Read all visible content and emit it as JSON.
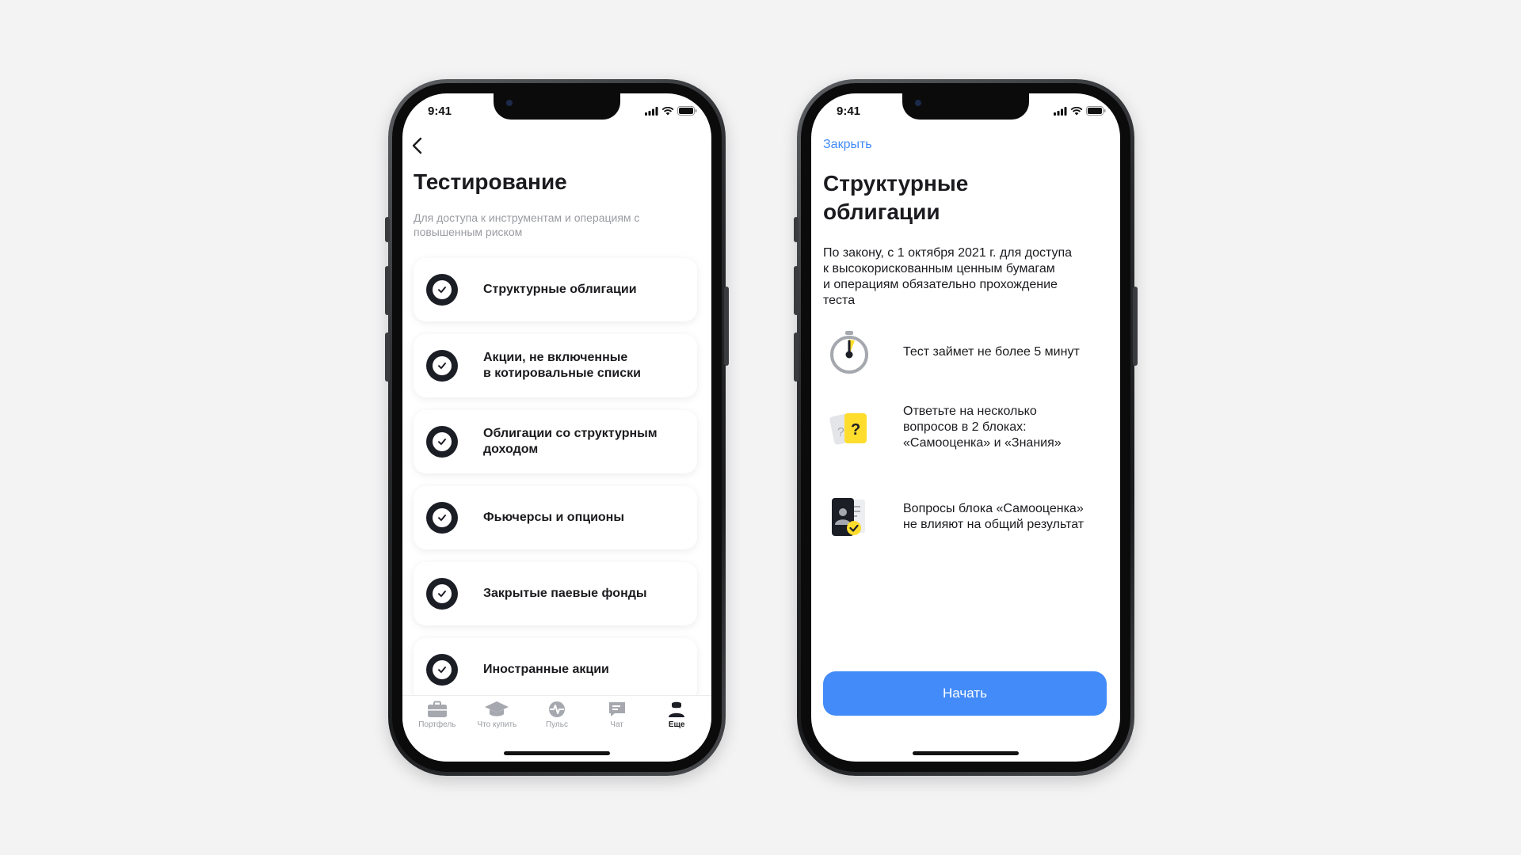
{
  "status_bar": {
    "time": "9:41"
  },
  "left_screen": {
    "title": "Тестирование",
    "subtitle": "Для доступа к инструментам и операциям с повышенным риском",
    "tests": [
      {
        "label": "Структурные облигации",
        "icon": "check-icon"
      },
      {
        "label": "Акции, не включенные\nв котировальные списки",
        "icon": "check-icon"
      },
      {
        "label": "Облигации со структурным\nдоходом",
        "icon": "check-icon"
      },
      {
        "label": "Фьючерсы и опционы",
        "icon": "check-icon"
      },
      {
        "label": "Закрытые паевые фонды",
        "icon": "check-icon"
      },
      {
        "label": "Иностранные акции",
        "icon": "check-icon"
      }
    ],
    "tabbar": [
      {
        "label": "Портфель",
        "icon": "briefcase-icon",
        "active": false
      },
      {
        "label": "Что купить",
        "icon": "graduation-cap-icon",
        "active": false
      },
      {
        "label": "Пульс",
        "icon": "pulse-icon",
        "active": false
      },
      {
        "label": "Чат",
        "icon": "chat-icon",
        "active": false
      },
      {
        "label": "Еще",
        "icon": "profile-icon",
        "active": true
      }
    ]
  },
  "right_screen": {
    "close_label": "Закрыть",
    "title": "Структурные\nоблигации",
    "intro": "По закону, с 1 октября 2021 г. для доступа\nк высокорискованным ценным бумагам\nи операциям обязательно прохождение\nтеста",
    "info": [
      {
        "text": "Тест займет не более 5 минут",
        "icon": "stopwatch-icon"
      },
      {
        "text": "Ответьте на несколько\nвопросов в 2 блоках:\n«Самооценка» и «Знания»",
        "icon": "question-cards-icon"
      },
      {
        "text": "Вопросы блока «Самооценка»\nне влияют на общий результат",
        "icon": "id-card-check-icon"
      }
    ],
    "start_label": "Начать"
  },
  "colors": {
    "accent_blue": "#428bf9",
    "dark": "#1c1e26",
    "yellow": "#ffdd2d",
    "background": "#f3f3f4"
  }
}
